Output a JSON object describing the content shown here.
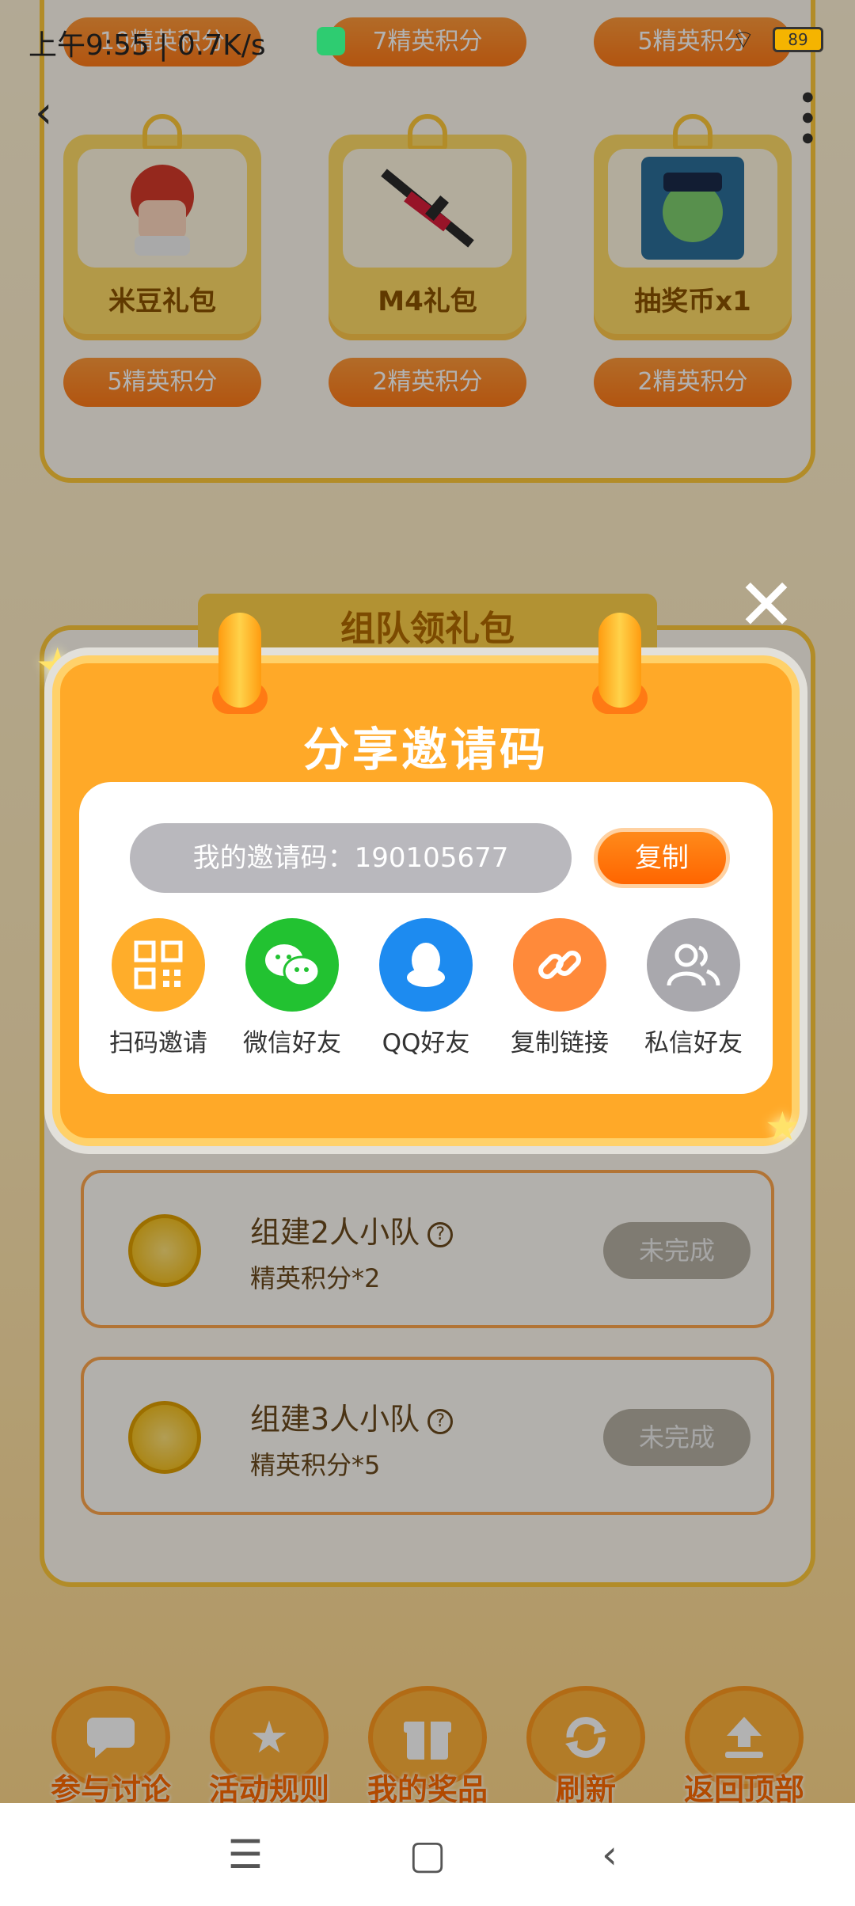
{
  "status_bar": {
    "time": "上午9:55 | 0.7K/s",
    "battery": "89"
  },
  "reward_section": {
    "top_pills": [
      "10精英积分",
      "7精英积分",
      "5精英积分"
    ],
    "cards": [
      {
        "name": "米豆礼包",
        "cost": "5精英积分"
      },
      {
        "name": "M4礼包",
        "cost": "2精英积分"
      },
      {
        "name": "抽奖币x1",
        "cost": "2精英积分"
      }
    ]
  },
  "team_section": {
    "title": "组队领礼包",
    "tasks": [
      {
        "title": "组建2人小队",
        "reward": "精英积分*2",
        "status": "未完成"
      },
      {
        "title": "组建3人小队",
        "reward": "精英积分*5",
        "status": "未完成"
      }
    ]
  },
  "bottom_bar": {
    "items": [
      {
        "label": "参与讨论",
        "icon": "chat-icon"
      },
      {
        "label": "活动规则",
        "icon": "star-icon"
      },
      {
        "label": "我的奖品",
        "icon": "gift-icon"
      },
      {
        "label": "刷新",
        "icon": "refresh-icon"
      },
      {
        "label": "返回顶部",
        "icon": "upload-icon"
      }
    ]
  },
  "dialog": {
    "title": "分享邀请码",
    "invite_code_text": "我的邀请码：190105677",
    "copy_label": "复制",
    "share_options": [
      {
        "label": "扫码邀请",
        "icon": "qr-code-icon",
        "color": "#ffad2a"
      },
      {
        "label": "微信好友",
        "icon": "wechat-icon",
        "color": "#22c231"
      },
      {
        "label": "QQ好友",
        "icon": "qq-icon",
        "color": "#1d8bf0"
      },
      {
        "label": "复制链接",
        "icon": "link-icon",
        "color": "#ff8a3a"
      },
      {
        "label": "私信好友",
        "icon": "people-icon",
        "color": "#a9a8ad"
      }
    ]
  },
  "system_nav": {
    "menu": "☰",
    "home": "▢",
    "back": "‹"
  },
  "symbols": {
    "back": "‹",
    "more": "•••",
    "close": "✕",
    "star": "★",
    "question": "?",
    "wifi": "⌔"
  }
}
